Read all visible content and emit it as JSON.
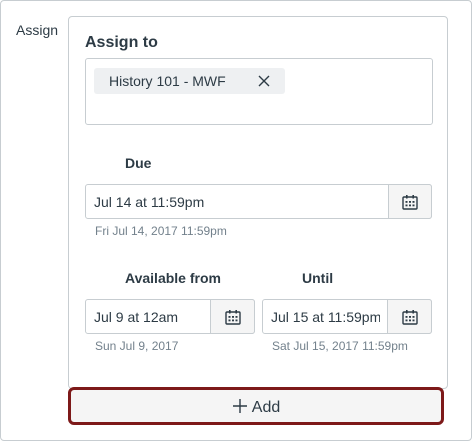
{
  "section_label": "Assign",
  "assign_to": {
    "heading": "Assign to",
    "token_label": "History 101 - MWF"
  },
  "due": {
    "label": "Due",
    "value": "Jul 14 at 11:59pm",
    "hint": "Fri Jul 14, 2017 11:59pm"
  },
  "available_from": {
    "label": "Available from",
    "value": "Jul 9 at 12am",
    "hint": "Sun Jul 9, 2017"
  },
  "until": {
    "label": "Until",
    "value": "Jul 15 at 11:59pm",
    "hint": "Sat Jul 15, 2017 11:59pm"
  },
  "add_button": {
    "label": "Add"
  },
  "icons": {
    "remove": "close-icon",
    "calendar": "calendar-icon",
    "add": "plus-icon"
  },
  "colors": {
    "highlight": "#7d1919",
    "text": "#2d3b45",
    "hint": "#73818c"
  }
}
